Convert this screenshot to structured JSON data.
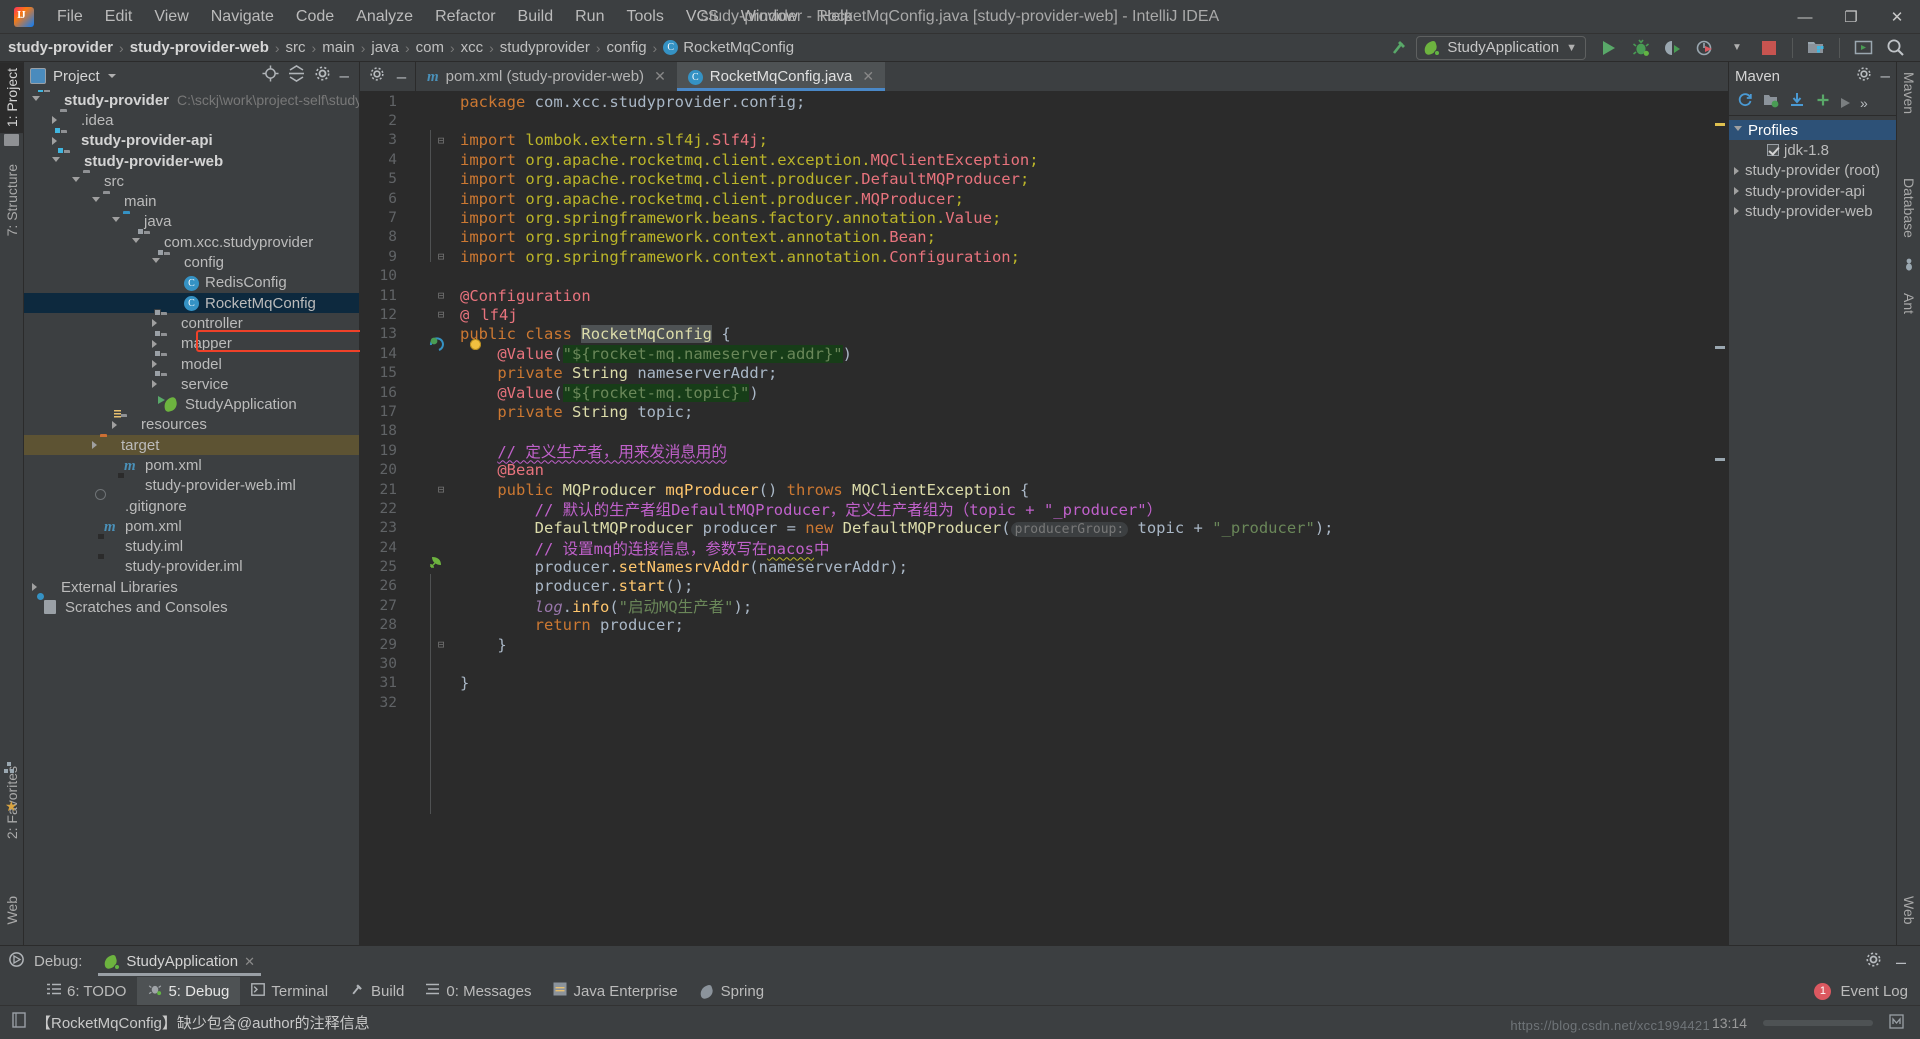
{
  "window": {
    "title": "study-provider - RocketMqConfig.java [study-provider-web] - IntelliJ IDEA",
    "minimize": "—",
    "maximize": "❐",
    "close": "✕"
  },
  "menubar": {
    "items": [
      "File",
      "Edit",
      "View",
      "Navigate",
      "Code",
      "Analyze",
      "Refactor",
      "Build",
      "Run",
      "Tools",
      "VCS",
      "Window",
      "Help"
    ]
  },
  "breadcrumb": {
    "items": [
      "study-provider",
      "study-provider-web",
      "src",
      "main",
      "java",
      "com",
      "xcc",
      "studyprovider",
      "config",
      "RocketMqConfig"
    ],
    "separator": "›",
    "class_badge": "C"
  },
  "toolbar": {
    "run_config": "StudyApplication",
    "dropdown_caret": "▼",
    "icons": [
      "build-hammer-icon",
      "run-icon",
      "debug-icon",
      "run-coverage-icon",
      "profiler-icon",
      "stop-icon",
      "project-structure-icon",
      "terminal-icon",
      "search-everywhere-icon"
    ]
  },
  "left_strip": {
    "tabs": [
      "1: Project",
      "7: Structure"
    ],
    "bottom_tabs": [
      "2: Favorites",
      "Web"
    ]
  },
  "project_panel": {
    "title": "Project",
    "header_icons": [
      "locate-icon",
      "collapse-all-icon",
      "settings-gear-icon",
      "hide-icon"
    ],
    "tree": [
      {
        "depth": 0,
        "arrow": "open",
        "icon": "module-folder",
        "label": "study-provider",
        "bold": true,
        "path": "C:\\sckj\\work\\project-self\\study-pr",
        "state": "normal"
      },
      {
        "depth": 1,
        "arrow": "closed",
        "icon": "folder",
        "label": ".idea",
        "bold": false,
        "path": "",
        "state": "normal"
      },
      {
        "depth": 1,
        "arrow": "closed",
        "icon": "module-folder",
        "label": "study-provider-api",
        "bold": true,
        "path": "",
        "state": "normal"
      },
      {
        "depth": 1,
        "arrow": "open",
        "icon": "module-folder",
        "label": "study-provider-web",
        "bold": true,
        "path": "",
        "state": "normal"
      },
      {
        "depth": 2,
        "arrow": "open",
        "icon": "folder",
        "label": "src",
        "bold": false,
        "path": "",
        "state": "normal"
      },
      {
        "depth": 3,
        "arrow": "open",
        "icon": "folder",
        "label": "main",
        "bold": false,
        "path": "",
        "state": "normal"
      },
      {
        "depth": 4,
        "arrow": "open",
        "icon": "source-folder",
        "label": "java",
        "bold": false,
        "path": "",
        "state": "normal"
      },
      {
        "depth": 5,
        "arrow": "open",
        "icon": "package",
        "label": "com.xcc.studyprovider",
        "bold": false,
        "path": "",
        "state": "normal"
      },
      {
        "depth": 6,
        "arrow": "open",
        "icon": "package",
        "label": "config",
        "bold": false,
        "path": "",
        "state": "normal"
      },
      {
        "depth": 7,
        "arrow": "none",
        "icon": "java-class",
        "label": "RedisConfig",
        "bold": false,
        "path": "",
        "state": "normal"
      },
      {
        "depth": 7,
        "arrow": "none",
        "icon": "java-class",
        "label": "RocketMqConfig",
        "bold": false,
        "path": "",
        "state": "selected"
      },
      {
        "depth": 6,
        "arrow": "closed",
        "icon": "package",
        "label": "controller",
        "bold": false,
        "path": "",
        "state": "normal"
      },
      {
        "depth": 6,
        "arrow": "closed",
        "icon": "package",
        "label": "mapper",
        "bold": false,
        "path": "",
        "state": "normal"
      },
      {
        "depth": 6,
        "arrow": "closed",
        "icon": "package",
        "label": "model",
        "bold": false,
        "path": "",
        "state": "normal"
      },
      {
        "depth": 6,
        "arrow": "closed",
        "icon": "package",
        "label": "service",
        "bold": false,
        "path": "",
        "state": "normal"
      },
      {
        "depth": 6,
        "arrow": "none",
        "icon": "spring-boot-class",
        "label": "StudyApplication",
        "bold": false,
        "path": "",
        "state": "normal"
      },
      {
        "depth": 4,
        "arrow": "closed",
        "icon": "resources-folder",
        "label": "resources",
        "bold": false,
        "path": "",
        "state": "normal"
      },
      {
        "depth": 3,
        "arrow": "closed",
        "icon": "target-folder",
        "label": "target",
        "bold": false,
        "path": "",
        "state": "excluded"
      },
      {
        "depth": 4,
        "arrow": "none",
        "icon": "maven-file",
        "label": "pom.xml",
        "bold": false,
        "path": "",
        "state": "normal"
      },
      {
        "depth": 4,
        "arrow": "none",
        "icon": "iml-file",
        "label": "study-provider-web.iml",
        "bold": false,
        "path": "",
        "state": "normal"
      },
      {
        "depth": 3,
        "arrow": "none",
        "icon": "gitignore-file",
        "label": ".gitignore",
        "bold": false,
        "path": "",
        "state": "normal"
      },
      {
        "depth": 3,
        "arrow": "none",
        "icon": "maven-file",
        "label": "pom.xml",
        "bold": false,
        "path": "",
        "state": "normal"
      },
      {
        "depth": 3,
        "arrow": "none",
        "icon": "iml-file",
        "label": "study.iml",
        "bold": false,
        "path": "",
        "state": "normal"
      },
      {
        "depth": 3,
        "arrow": "none",
        "icon": "iml-file",
        "label": "study-provider.iml",
        "bold": false,
        "path": "",
        "state": "normal"
      },
      {
        "depth": 0,
        "arrow": "closed",
        "icon": "libraries",
        "label": "External Libraries",
        "bold": false,
        "path": "",
        "state": "normal"
      },
      {
        "depth": 0,
        "arrow": "none",
        "icon": "scratches",
        "label": "Scratches and Consoles",
        "bold": false,
        "path": "",
        "state": "normal"
      }
    ]
  },
  "editor": {
    "tabs": [
      {
        "label": "pom.xml (study-provider-web)",
        "icon": "maven-file",
        "active": false,
        "close": "✕"
      },
      {
        "label": "RocketMqConfig.java",
        "icon": "java-class",
        "active": true,
        "close": "✕"
      }
    ],
    "gutter_icons": [
      "settings-gear-icon",
      "hide-panel-icon"
    ],
    "lines": [
      {
        "n": 1,
        "fold": "",
        "html": "<span class='kw'>package</span> com.xcc.studyprovider.config;"
      },
      {
        "n": 2,
        "fold": "",
        "html": ""
      },
      {
        "n": 3,
        "fold": "minus",
        "html": "<span class='kw'>import</span> <span class='ann'>lombok.extern.slf4j.</span><span class='annred'>Slf4j</span><span class='ann'>;</span>"
      },
      {
        "n": 4,
        "fold": "",
        "html": "<span class='kw'>import</span> <span class='ann'>org.apache.rocketmq.client.exception.</span><span class='annred'>MQClientException</span><span class='ann'>;</span>"
      },
      {
        "n": 5,
        "fold": "",
        "html": "<span class='kw'>import</span> <span class='ann'>org.apache.rocketmq.client.producer.</span><span class='annred'>DefaultMQProducer</span><span class='ann'>;</span>"
      },
      {
        "n": 6,
        "fold": "",
        "html": "<span class='kw'>import</span> <span class='ann'>org.apache.rocketmq.client.producer.</span><span class='annred'>MQProducer</span><span class='ann'>;</span>"
      },
      {
        "n": 7,
        "fold": "",
        "html": "<span class='kw'>import</span> <span class='ann'>org.springframework.beans.factory.annotation.</span><span class='annred'>Value</span><span class='ann'>;</span>"
      },
      {
        "n": 8,
        "fold": "",
        "html": "<span class='kw'>import</span> <span class='ann'>org.springframework.context.annotation.</span><span class='annred'>Bean</span><span class='ann'>;</span>"
      },
      {
        "n": 9,
        "fold": "minus",
        "html": "<span class='kw'>import</span> <span class='ann'>org.springframework.context.annotation.</span><span class='annred'>Configuration</span><span class='ann'>;</span>"
      },
      {
        "n": 10,
        "fold": "",
        "html": ""
      },
      {
        "n": 11,
        "fold": "minus",
        "html": "<span class='annred'>@Configuration</span>"
      },
      {
        "n": 12,
        "fold": "minus",
        "html": "<span class='annred'>@</span><span class='annred' style='padding-left:11px'>lf4j</span>"
      },
      {
        "n": 13,
        "fold": "",
        "html": "<span class='kw'>public</span> <span class='kw'>class</span> <span class='selbg cls'>RocketMqConfig</span> {"
      },
      {
        "n": 14,
        "fold": "",
        "html": "    <span class='annred'>@Value</span>(<span class='strbg'>\"${rocket-mq.nameserver.addr}\"</span>)"
      },
      {
        "n": 15,
        "fold": "",
        "html": "    <span class='kw'>private</span> <span class='cls'>String</span> nameserverAddr;"
      },
      {
        "n": 16,
        "fold": "",
        "html": "    <span class='annred'>@Value</span>(<span class='strbg'>\"${rocket-mq.topic}\"</span>)"
      },
      {
        "n": 17,
        "fold": "",
        "html": "    <span class='kw'>private</span> <span class='cls'>String</span> topic;"
      },
      {
        "n": 18,
        "fold": "",
        "html": ""
      },
      {
        "n": 19,
        "fold": "",
        "html": "    <span class='cmtcn wavy'>// 定义生产者，用来发消息用的</span>"
      },
      {
        "n": 20,
        "fold": "",
        "html": "    <span class='annred'>@Bean</span>"
      },
      {
        "n": 21,
        "fold": "minus",
        "html": "    <span class='kw'>public</span> <span class='cls'>MQProducer</span> <span class='fn'>mqProducer</span>() <span class='kw'>throws</span> <span class='cls'>MQClientException</span> {"
      },
      {
        "n": 22,
        "fold": "",
        "html": "        <span class='cmtcn'>// 默认的生产者组DefaultMQProducer，定义生产者组为（topic + \"_producer\"）</span>"
      },
      {
        "n": 23,
        "fold": "",
        "html": "        <span class='cls'>DefaultMQProducer</span> producer = <span class='kw'>new</span> <span class='cls'>DefaultMQProducer</span>(<span class='hint'>producerGroup:</span> topic + <span class='str'>\"_producer\"</span>);"
      },
      {
        "n": 24,
        "fold": "",
        "html": "        <span class='cmtcn'>// 设置mq的连接信息，参数写在<span class='wavy2'>nacos</span>中</span>"
      },
      {
        "n": 25,
        "fold": "",
        "html": "        producer.<span class='fn'>setNamesrvAddr</span>(nameserverAddr);"
      },
      {
        "n": 26,
        "fold": "",
        "html": "        producer.<span class='fn'>start</span>();"
      },
      {
        "n": 27,
        "fold": "",
        "html": "        <span class='fld2'>log</span>.<span class='fn'>info</span>(<span class='str'>\"启动MQ生产者\"</span>);"
      },
      {
        "n": 28,
        "fold": "",
        "html": "        <span class='kw'>return</span> producer;"
      },
      {
        "n": 29,
        "fold": "minus",
        "html": "    }"
      },
      {
        "n": 30,
        "fold": "",
        "html": ""
      },
      {
        "n": 31,
        "fold": "",
        "html": "}"
      },
      {
        "n": 32,
        "fold": "",
        "html": ""
      }
    ]
  },
  "maven_panel": {
    "title": "Maven",
    "header_icons": [
      "settings-gear-icon",
      "hide-icon"
    ],
    "toolbar_icons": [
      "reimport-icon",
      "generate-sources-icon",
      "download-sources-icon",
      "add-maven-project-icon",
      "run-maven-goal-icon",
      "more-icon"
    ],
    "tree": [
      {
        "depth": 0,
        "arrow": "open",
        "label": "Profiles",
        "selected": true,
        "checkbox": false
      },
      {
        "depth": 1,
        "arrow": "none",
        "label": "jdk-1.8",
        "selected": false,
        "checkbox": true
      },
      {
        "depth": 0,
        "arrow": "closed",
        "label": "study-provider (root)",
        "selected": false,
        "checkbox": false
      },
      {
        "depth": 0,
        "arrow": "closed",
        "label": "study-provider-api",
        "selected": false,
        "checkbox": false
      },
      {
        "depth": 0,
        "arrow": "closed",
        "label": "study-provider-web",
        "selected": false,
        "checkbox": false
      }
    ]
  },
  "right_strip": {
    "tabs": [
      "Maven",
      "Database",
      "Ant",
      "Web"
    ]
  },
  "debug_bar": {
    "label": "Debug:",
    "session": "StudyApplication",
    "close": "✕",
    "right_icons": [
      "settings-gear-icon",
      "hide-icon"
    ]
  },
  "bottom_toolbar": {
    "items": [
      {
        "label": "6: TODO",
        "icon": "todo-icon",
        "active": false
      },
      {
        "label": "5: Debug",
        "icon": "debug-icon",
        "active": true
      },
      {
        "label": "Terminal",
        "icon": "terminal-icon",
        "active": false
      },
      {
        "label": "Build",
        "icon": "build-hammer-icon",
        "active": false
      },
      {
        "label": "0: Messages",
        "icon": "messages-icon",
        "active": false
      },
      {
        "label": "Java Enterprise",
        "icon": "java-enterprise-icon",
        "active": false
      },
      {
        "label": "Spring",
        "icon": "spring-leaf-icon",
        "active": false
      }
    ],
    "event_log": "Event Log",
    "event_count": "1"
  },
  "status_bar": {
    "message": "【RocketMqConfig】缺少包含@author的注释信息",
    "time": "13:14",
    "watermark": "https://blog.csdn.net/xcc1994421"
  },
  "colors": {
    "accent_blue": "#4a88c7",
    "selection": "#0d293e",
    "highlight_red": "#ef4129",
    "excluded_brown": "#5d5333",
    "editor_bg": "#2b2b2b",
    "panel_bg": "#3c3f41"
  }
}
